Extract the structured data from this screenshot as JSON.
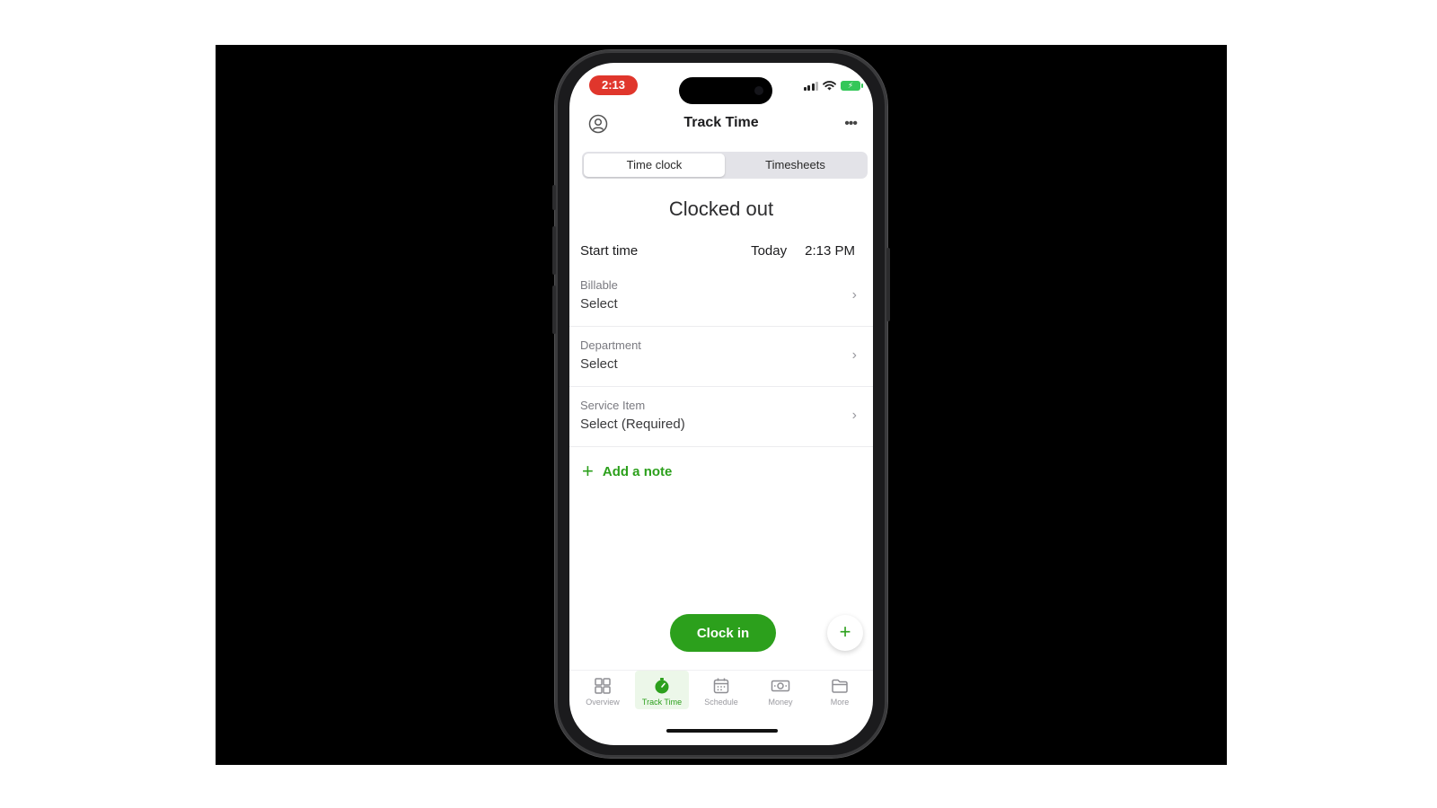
{
  "status_bar": {
    "time": "2:13"
  },
  "navbar": {
    "title": "Track Time",
    "more": "•••"
  },
  "segmented": {
    "tabs": [
      "Time clock",
      "Timesheets"
    ],
    "active": "Time clock"
  },
  "heading": "Clocked out",
  "start_time": {
    "label": "Start time",
    "date": "Today",
    "time": "2:13 PM"
  },
  "fields": [
    {
      "label": "Billable",
      "value": "Select"
    },
    {
      "label": "Department",
      "value": "Select"
    },
    {
      "label": "Service Item",
      "value": "Select (Required)"
    }
  ],
  "add_note": {
    "label": "Add a note"
  },
  "clock_in": {
    "label": "Clock in"
  },
  "fab": {
    "symbol": "+"
  },
  "tabbar": {
    "items": [
      {
        "label": "Overview",
        "icon": "grid-icon"
      },
      {
        "label": "Track Time",
        "icon": "stopwatch-icon"
      },
      {
        "label": "Schedule",
        "icon": "calendar-icon"
      },
      {
        "label": "Money",
        "icon": "money-icon"
      },
      {
        "label": "More",
        "icon": "folder-icon"
      }
    ],
    "active": "Track Time"
  },
  "colors": {
    "accent": "#2ca01c",
    "status_time_bg": "#e0362c"
  }
}
